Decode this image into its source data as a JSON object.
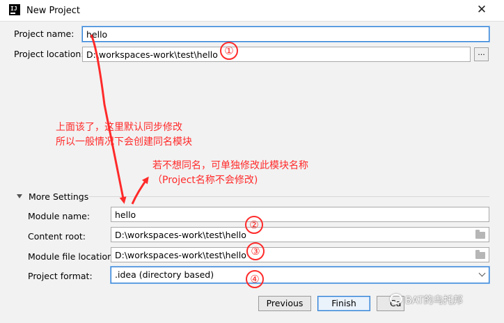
{
  "window": {
    "title": "New Project",
    "app_icon_text": "IJ"
  },
  "project": {
    "name_label": "Project name:",
    "name_value": "hello",
    "location_label": "Project location:",
    "location_value": "D:\\workspaces-work\\test\\hello",
    "browse_label": "..."
  },
  "more_settings": {
    "header": "More Settings",
    "module_name_label": "Module name:",
    "module_name_value": "hello",
    "content_root_label": "Content root:",
    "content_root_value": "D:\\workspaces-work\\test\\hello",
    "module_file_label": "Module file location:",
    "module_file_value": "D:\\workspaces-work\\test\\hello",
    "format_label": "Project format:",
    "format_value": ".idea (directory based)"
  },
  "buttons": {
    "previous": "Previous",
    "finish": "Finish",
    "cancel": "Ca"
  },
  "annotations": {
    "note1_line1": "上面该了，这里默认同步修改",
    "note1_line2": "所以一般情况下会创建同名模块",
    "note2_line1": "若不想同名，可单独修改此模块名称",
    "note2_line2": "（Project名称不会修改)",
    "circle1": "①",
    "circle2": "②",
    "circle3": "③",
    "circle4": "④"
  },
  "watermark": "BAT的乌托邦",
  "colors": {
    "annotation": "#ff2a2a",
    "focus": "#2f7fd2"
  },
  "icons": [
    "app-icon",
    "close-icon",
    "folder-icon",
    "chevron-down-icon",
    "collapse-triangle-icon",
    "wechat-icon"
  ]
}
